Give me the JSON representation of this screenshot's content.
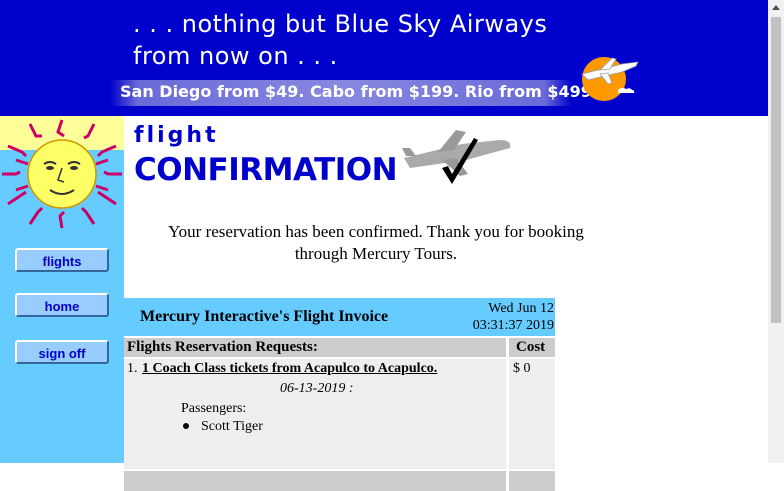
{
  "banner": {
    "tagline_line1": ". . . nothing but Blue Sky Airways",
    "tagline_line2": "from now on . . .",
    "deals": "San Diego from $49. Cabo from $199. Rio from $499."
  },
  "sidebar": {
    "buttons": [
      {
        "label": "flights"
      },
      {
        "label": "home"
      },
      {
        "label": "sign off"
      }
    ]
  },
  "heading": {
    "line1": "flight",
    "line2": "CONFIRMATION"
  },
  "confirmation_message": "Your reservation has been confirmed. Thank you for booking through Mercury Tours.",
  "invoice": {
    "title": "Mercury Interactive's Flight Invoice",
    "date": "Wed Jun 12",
    "time": "03:31:37 2019",
    "columns": {
      "requests": "Flights Reservation Requests:",
      "cost": "Cost"
    },
    "items": [
      {
        "number": "1.",
        "title": "1 Coach Class tickets from Acapulco to Acapulco.",
        "date": "06-13-2019 :",
        "passengers_label": "Passengers:",
        "passengers": [
          "Scott Tiger"
        ],
        "cost": "$ 0"
      }
    ]
  },
  "colors": {
    "banner_blue": "#0000cc",
    "sidebar_cyan": "#66ccff",
    "row_gray": "#cccccc",
    "row_light": "#eeeeee"
  }
}
